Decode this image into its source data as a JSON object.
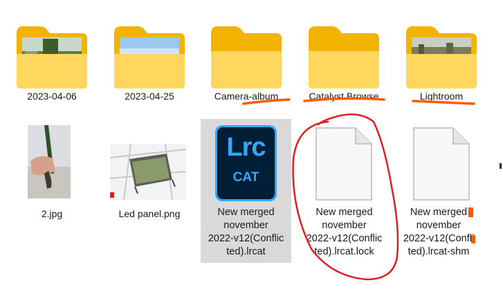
{
  "explorer": {
    "row1": [
      {
        "name": "2023-04-06"
      },
      {
        "name": "2023-04-25"
      },
      {
        "name": "Camera-album"
      },
      {
        "name": "Catalyst Browse"
      },
      {
        "name": "Lightroom"
      }
    ],
    "row2": [
      {
        "name": "2.jpg"
      },
      {
        "name": "Led panel.png"
      },
      {
        "name": "New merged\nnovember\n2022-v12(Conflic\nted).lrcat",
        "selected": true
      },
      {
        "name": "New merged\nnovember\n2022-v12(Conflic\nted).lrcat.lock"
      },
      {
        "name": "New merged\nnovember\n2022-v12(Confli\nted).lrcat-shm"
      }
    ],
    "lrc_icon": {
      "main": "Lrc",
      "sub": "CAT"
    }
  },
  "colors": {
    "folder_back": "#f2b400",
    "folder_front": "#ffd75e",
    "selection": "#d9d9d9",
    "lrc_blue": "#31a8ff",
    "lrc_dark": "#001e36",
    "annotation_red": "#e21c23",
    "annotation_orange": "#ff5a00"
  },
  "icons": [
    "folder-icon",
    "image-thumbnail",
    "lightroom-catalog-icon",
    "generic-file-icon"
  ]
}
